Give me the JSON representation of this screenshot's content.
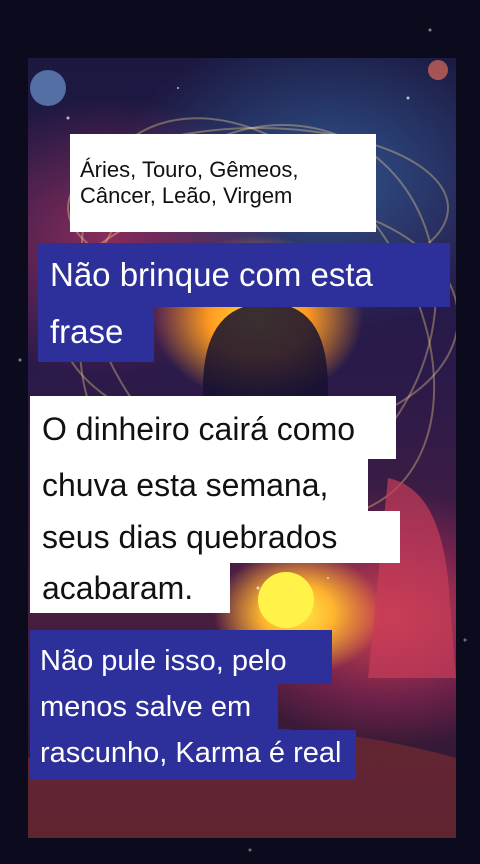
{
  "signs": {
    "line1": "Áries, Touro, Gêmeos,",
    "line2": "Câncer, Leão, Virgem"
  },
  "warning": {
    "line1": "Não brinque com esta",
    "line2": "frase"
  },
  "message": {
    "line1": "O dinheiro cairá como",
    "line2": "chuva esta semana,",
    "line3": "seus dias quebrados",
    "line4": "acabaram."
  },
  "call_to_action": {
    "line1": "Não pule isso, pelo",
    "line2": "menos salve em",
    "line3": "rascunho, Karma é real"
  },
  "colors": {
    "caption_blue": "#2d2f9a",
    "caption_white": "#ffffff"
  }
}
